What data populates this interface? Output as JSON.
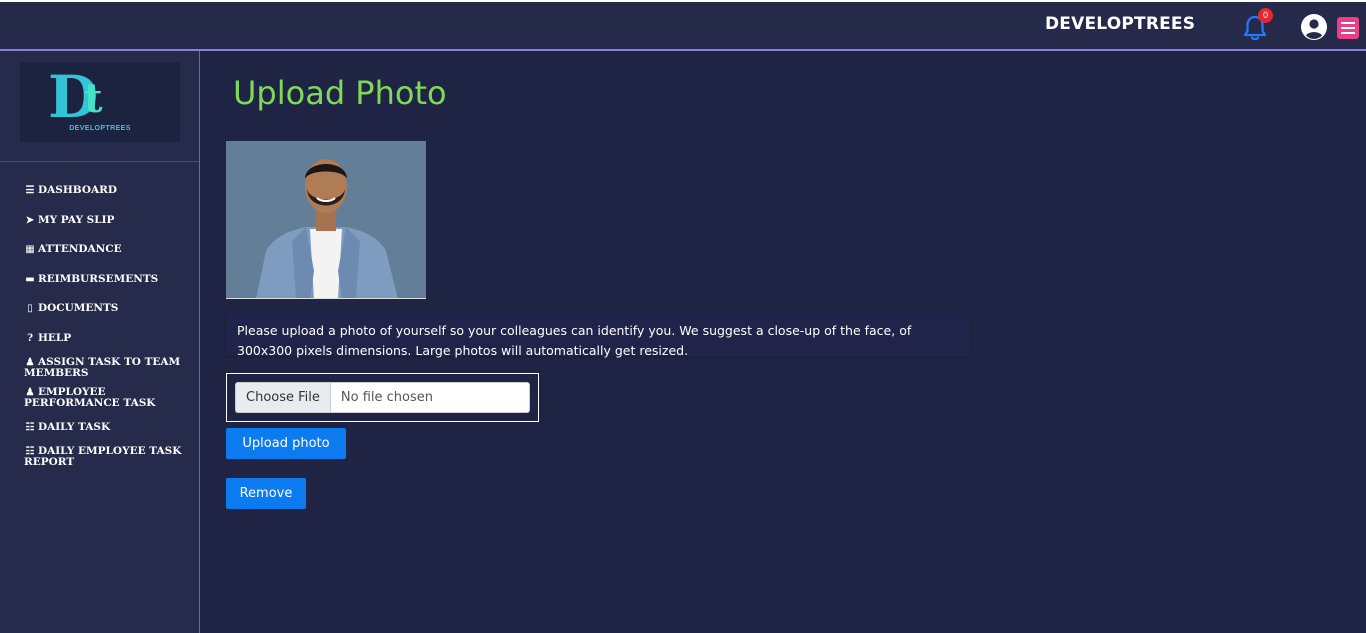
{
  "header": {
    "brand": "DEVELOPTREES",
    "notification_count": "0"
  },
  "logo": {
    "letters_main": "D",
    "letters_secondary": "t",
    "text": "DEVELOPTREES"
  },
  "sidebar": {
    "items": [
      {
        "icon": "bars-icon",
        "glyph": "☰",
        "label": "DASHBOARD"
      },
      {
        "icon": "paper-plane-icon",
        "glyph": "➤",
        "label": "MY PAY SLIP"
      },
      {
        "icon": "calendar-icon",
        "glyph": "▦",
        "label": "ATTENDANCE"
      },
      {
        "icon": "credit-card-icon",
        "glyph": "▬",
        "label": "REIMBURSEMENTS"
      },
      {
        "icon": "file-icon",
        "glyph": "▯",
        "label": "DOCUMENTS"
      },
      {
        "icon": "question-circle-icon",
        "glyph": "?",
        "label": "HELP"
      },
      {
        "icon": "users-icon",
        "glyph": "♟",
        "label": "ASSIGN TASK TO TEAM",
        "label2": "MEMBERS"
      },
      {
        "icon": "user-cog-icon",
        "glyph": "♟",
        "label": "EMPLOYEE",
        "label2": "PERFORMANCE TASK"
      },
      {
        "icon": "tasks-icon",
        "glyph": "☷",
        "label": "DAILY TASK"
      },
      {
        "icon": "tasks-icon",
        "glyph": "☷",
        "label": "DAILY EMPLOYEE TASK",
        "label2": "REPORT"
      }
    ]
  },
  "main": {
    "title": "Upload Photo",
    "info_line1": "Please upload a photo of yourself so your colleagues can identify you. We suggest a close-up of the face, of",
    "info_line2": "300x300 pixels dimensions. Large photos will automatically get resized.",
    "file_button": "Choose File",
    "file_status": "No file chosen",
    "upload_button": "Upload photo",
    "remove_button": "Remove"
  },
  "colors": {
    "background": "#202444",
    "title": "#7ed957",
    "primary_button": "#0d7bf0",
    "menu_icon": "#ea3f88",
    "badge": "#e8262d",
    "bell": "#1f7bff"
  }
}
